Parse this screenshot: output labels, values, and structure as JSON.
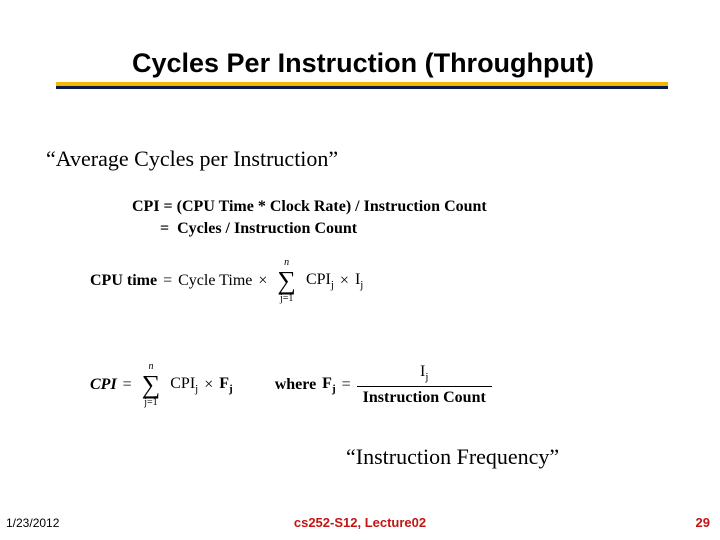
{
  "title": "Cycles Per Instruction (Throughput)",
  "subhead": "“Average Cycles per Instruction”",
  "cpi_line1": "CPI = (CPU Time * Clock Rate) / Instruction Count",
  "cpi_line2_lhs": "       =  Cycles / Instruction Count",
  "eq1": {
    "lhs": "CPU time",
    "eq": "=",
    "ct": "Cycle Time",
    "times": "×",
    "sum_top": "n",
    "sum_sym": "∑",
    "sum_bot": "j=1",
    "cpi": "CPI",
    "cpi_sub": "j",
    "times2": "×",
    "I": "I",
    "I_sub": "j"
  },
  "eq2": {
    "lhs": "CPI",
    "eq": "=",
    "sum_top": "n",
    "sum_sym": "∑",
    "sum_bot": "j=1",
    "cpi": "CPI",
    "cpi_sub": "j",
    "times": "×",
    "F": "F",
    "F_sub": "j",
    "where": "where",
    "F2": "F",
    "F2_sub": "j",
    "eq2": "=",
    "frac_num_I": "I",
    "frac_num_sub": "j",
    "frac_den": "Instruction Count"
  },
  "instr_freq": "“Instruction Frequency”",
  "footer": {
    "date": "1/23/2012",
    "center": "cs252-S12, Lecture02",
    "page": "29"
  }
}
